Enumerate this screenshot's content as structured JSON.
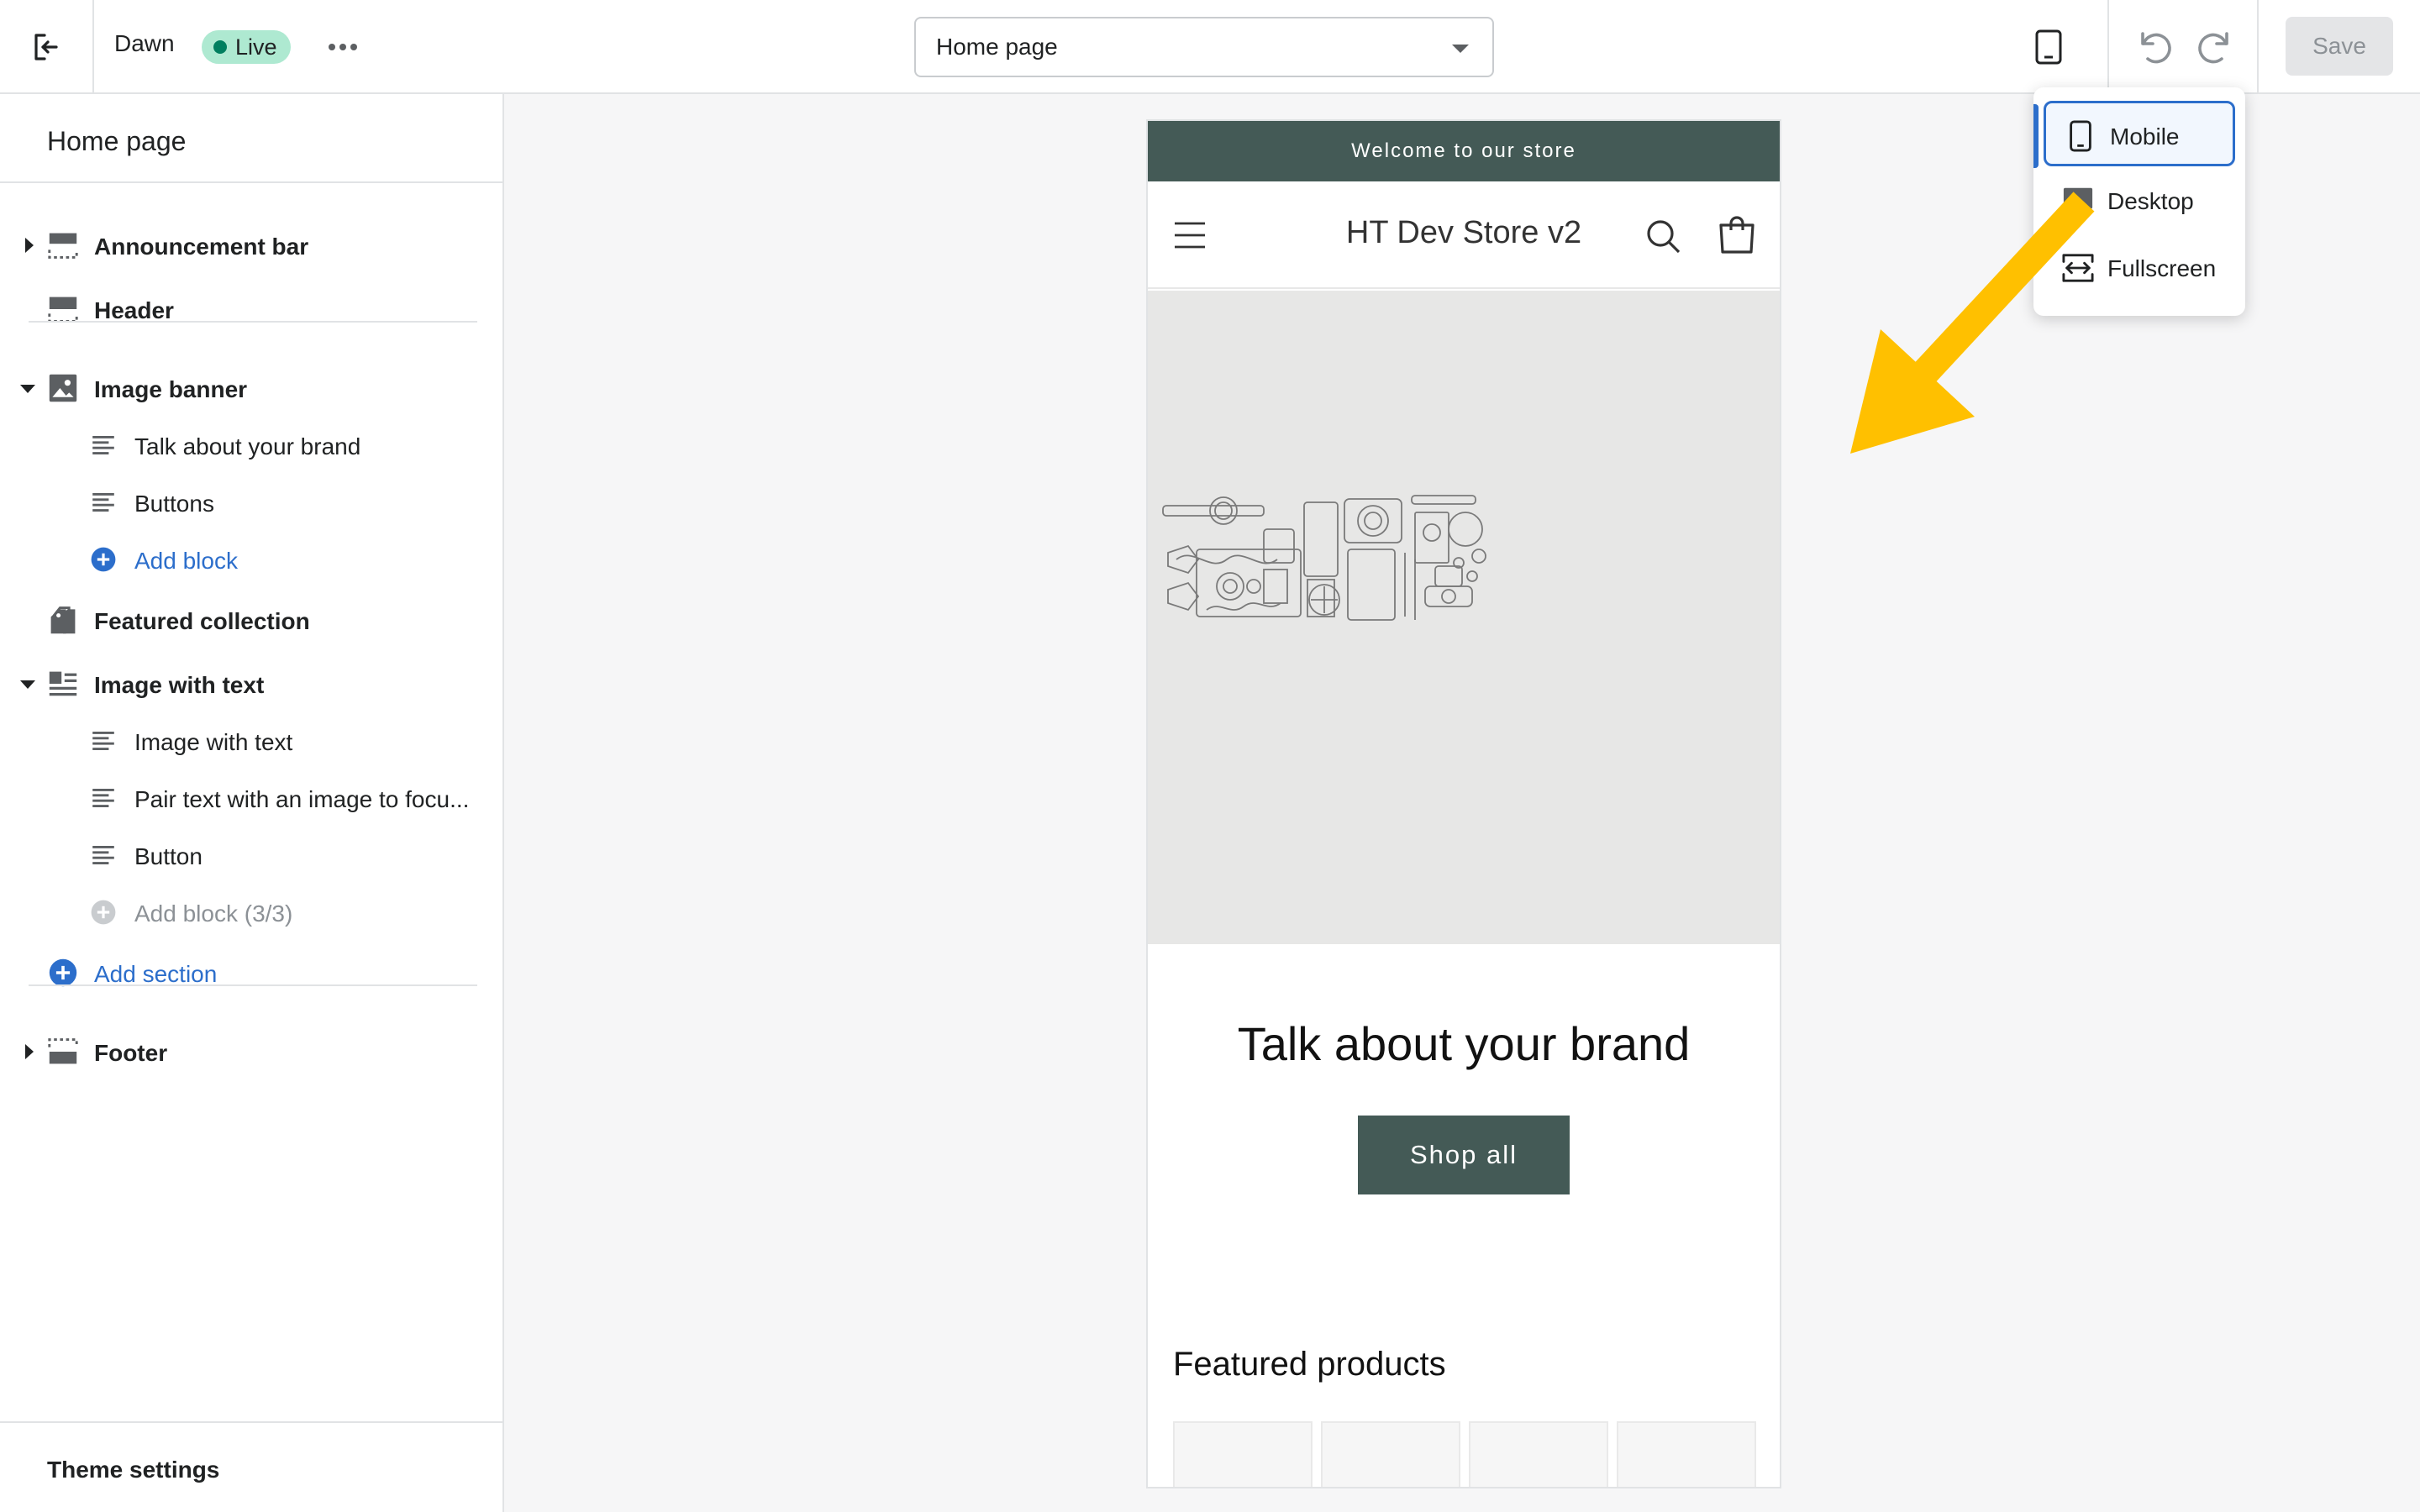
{
  "topbar": {
    "theme_name": "Dawn",
    "live_label": "Live",
    "page_select_value": "Home page",
    "save_label": "Save"
  },
  "sidebar": {
    "title": "Home page",
    "sections": [
      {
        "label": "Announcement bar"
      },
      {
        "label": "Header"
      },
      {
        "label": "Image banner"
      },
      {
        "label": "Talk about your brand"
      },
      {
        "label": "Buttons"
      },
      {
        "label": "Add block"
      },
      {
        "label": "Featured collection"
      },
      {
        "label": "Image with text"
      },
      {
        "label": "Image with text"
      },
      {
        "label": "Pair text with an image to focu..."
      },
      {
        "label": "Button"
      },
      {
        "label": "Add block (3/3)"
      },
      {
        "label": "Add section"
      },
      {
        "label": "Footer"
      }
    ],
    "footer_label": "Theme settings"
  },
  "preview": {
    "announcement": "Welcome to our store",
    "store_name": "HT Dev Store v2",
    "banner_heading": "Talk about your brand",
    "button_label": "Shop all",
    "featured_heading": "Featured products"
  },
  "device_menu": {
    "items": [
      {
        "label": "Mobile",
        "selected": true
      },
      {
        "label": "Desktop"
      },
      {
        "label": "Fullscreen"
      }
    ]
  },
  "colors": {
    "accent": "#2c6ecb",
    "preview_dark": "#445a56",
    "live_badge": "#aee9d1",
    "arrow": "#ffc000"
  }
}
